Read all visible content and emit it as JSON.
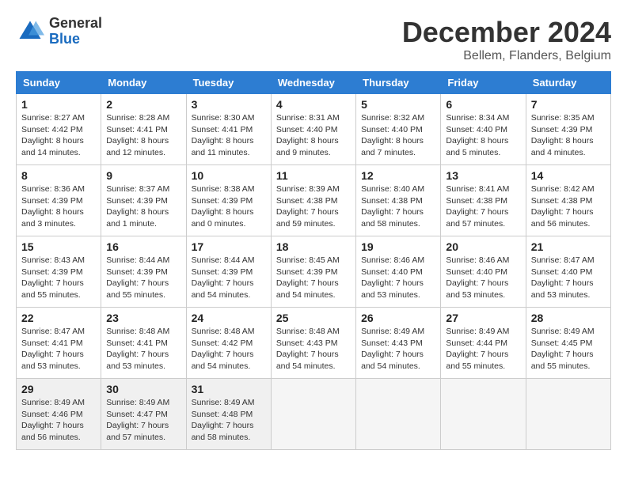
{
  "header": {
    "logo_general": "General",
    "logo_blue": "Blue",
    "month_title": "December 2024",
    "location": "Bellem, Flanders, Belgium"
  },
  "weekdays": [
    "Sunday",
    "Monday",
    "Tuesday",
    "Wednesday",
    "Thursday",
    "Friday",
    "Saturday"
  ],
  "weeks": [
    [
      {
        "day": "1",
        "sunrise": "8:27 AM",
        "sunset": "4:42 PM",
        "daylight": "8 hours and 14 minutes."
      },
      {
        "day": "2",
        "sunrise": "8:28 AM",
        "sunset": "4:41 PM",
        "daylight": "8 hours and 12 minutes."
      },
      {
        "day": "3",
        "sunrise": "8:30 AM",
        "sunset": "4:41 PM",
        "daylight": "8 hours and 11 minutes."
      },
      {
        "day": "4",
        "sunrise": "8:31 AM",
        "sunset": "4:40 PM",
        "daylight": "8 hours and 9 minutes."
      },
      {
        "day": "5",
        "sunrise": "8:32 AM",
        "sunset": "4:40 PM",
        "daylight": "8 hours and 7 minutes."
      },
      {
        "day": "6",
        "sunrise": "8:34 AM",
        "sunset": "4:40 PM",
        "daylight": "8 hours and 5 minutes."
      },
      {
        "day": "7",
        "sunrise": "8:35 AM",
        "sunset": "4:39 PM",
        "daylight": "8 hours and 4 minutes."
      }
    ],
    [
      {
        "day": "8",
        "sunrise": "8:36 AM",
        "sunset": "4:39 PM",
        "daylight": "8 hours and 3 minutes."
      },
      {
        "day": "9",
        "sunrise": "8:37 AM",
        "sunset": "4:39 PM",
        "daylight": "8 hours and 1 minute."
      },
      {
        "day": "10",
        "sunrise": "8:38 AM",
        "sunset": "4:39 PM",
        "daylight": "8 hours and 0 minutes."
      },
      {
        "day": "11",
        "sunrise": "8:39 AM",
        "sunset": "4:38 PM",
        "daylight": "7 hours and 59 minutes."
      },
      {
        "day": "12",
        "sunrise": "8:40 AM",
        "sunset": "4:38 PM",
        "daylight": "7 hours and 58 minutes."
      },
      {
        "day": "13",
        "sunrise": "8:41 AM",
        "sunset": "4:38 PM",
        "daylight": "7 hours and 57 minutes."
      },
      {
        "day": "14",
        "sunrise": "8:42 AM",
        "sunset": "4:38 PM",
        "daylight": "7 hours and 56 minutes."
      }
    ],
    [
      {
        "day": "15",
        "sunrise": "8:43 AM",
        "sunset": "4:39 PM",
        "daylight": "7 hours and 55 minutes."
      },
      {
        "day": "16",
        "sunrise": "8:44 AM",
        "sunset": "4:39 PM",
        "daylight": "7 hours and 55 minutes."
      },
      {
        "day": "17",
        "sunrise": "8:44 AM",
        "sunset": "4:39 PM",
        "daylight": "7 hours and 54 minutes."
      },
      {
        "day": "18",
        "sunrise": "8:45 AM",
        "sunset": "4:39 PM",
        "daylight": "7 hours and 54 minutes."
      },
      {
        "day": "19",
        "sunrise": "8:46 AM",
        "sunset": "4:40 PM",
        "daylight": "7 hours and 53 minutes."
      },
      {
        "day": "20",
        "sunrise": "8:46 AM",
        "sunset": "4:40 PM",
        "daylight": "7 hours and 53 minutes."
      },
      {
        "day": "21",
        "sunrise": "8:47 AM",
        "sunset": "4:40 PM",
        "daylight": "7 hours and 53 minutes."
      }
    ],
    [
      {
        "day": "22",
        "sunrise": "8:47 AM",
        "sunset": "4:41 PM",
        "daylight": "7 hours and 53 minutes."
      },
      {
        "day": "23",
        "sunrise": "8:48 AM",
        "sunset": "4:41 PM",
        "daylight": "7 hours and 53 minutes."
      },
      {
        "day": "24",
        "sunrise": "8:48 AM",
        "sunset": "4:42 PM",
        "daylight": "7 hours and 54 minutes."
      },
      {
        "day": "25",
        "sunrise": "8:48 AM",
        "sunset": "4:43 PM",
        "daylight": "7 hours and 54 minutes."
      },
      {
        "day": "26",
        "sunrise": "8:49 AM",
        "sunset": "4:43 PM",
        "daylight": "7 hours and 54 minutes."
      },
      {
        "day": "27",
        "sunrise": "8:49 AM",
        "sunset": "4:44 PM",
        "daylight": "7 hours and 55 minutes."
      },
      {
        "day": "28",
        "sunrise": "8:49 AM",
        "sunset": "4:45 PM",
        "daylight": "7 hours and 55 minutes."
      }
    ],
    [
      {
        "day": "29",
        "sunrise": "8:49 AM",
        "sunset": "4:46 PM",
        "daylight": "7 hours and 56 minutes."
      },
      {
        "day": "30",
        "sunrise": "8:49 AM",
        "sunset": "4:47 PM",
        "daylight": "7 hours and 57 minutes."
      },
      {
        "day": "31",
        "sunrise": "8:49 AM",
        "sunset": "4:48 PM",
        "daylight": "7 hours and 58 minutes."
      },
      null,
      null,
      null,
      null
    ]
  ]
}
